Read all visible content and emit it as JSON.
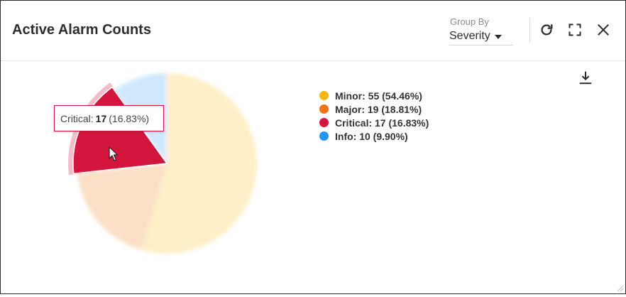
{
  "widget": {
    "title": "Active Alarm Counts",
    "group_by_label": "Group By",
    "group_by_value": "Severity",
    "toolbar_icons": [
      "refresh-icon",
      "expand-icon",
      "close-icon",
      "download-icon"
    ]
  },
  "tooltip": {
    "series": "Critical",
    "value": "17",
    "percent": "(16.83%)"
  },
  "legend": {
    "items": [
      {
        "label": "Minor: 55 (54.46%)",
        "color": "#f9b614"
      },
      {
        "label": "Major: 19 (18.81%)",
        "color": "#ee7411"
      },
      {
        "label": "Critical: 17 (16.83%)",
        "color": "#d4163f"
      },
      {
        "label": "Info: 10 (9.90%)",
        "color": "#2196f3"
      }
    ]
  },
  "chart_data": {
    "type": "pie",
    "categories": [
      "Minor",
      "Major",
      "Critical",
      "Info"
    ],
    "values": [
      55,
      19,
      17,
      10
    ],
    "percentages": [
      54.46,
      18.81,
      16.83,
      9.9
    ],
    "colors": [
      "#f9b614",
      "#ee7411",
      "#d4163f",
      "#2196f3"
    ],
    "highlighted": "Critical",
    "legend_position": "right"
  }
}
